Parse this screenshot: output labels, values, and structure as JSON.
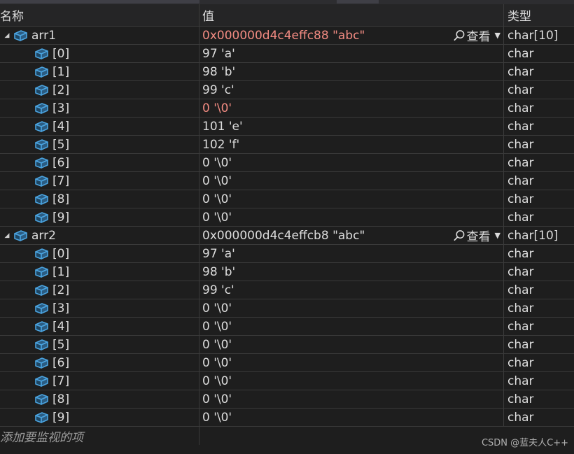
{
  "columns": {
    "name": "名称",
    "value": "值",
    "type": "类型"
  },
  "variables": [
    {
      "name": "arr1",
      "value": "0x000000d4c4effc88 \"abc\"",
      "value_changed": true,
      "type": "char[10]",
      "viewer_label": "查看",
      "children": [
        {
          "name": "[0]",
          "value": "97 'a'",
          "type": "char",
          "changed": false
        },
        {
          "name": "[1]",
          "value": "98 'b'",
          "type": "char",
          "changed": false
        },
        {
          "name": "[2]",
          "value": "99 'c'",
          "type": "char",
          "changed": false
        },
        {
          "name": "[3]",
          "value": "0 '\\0'",
          "type": "char",
          "changed": true
        },
        {
          "name": "[4]",
          "value": "101 'e'",
          "type": "char",
          "changed": false
        },
        {
          "name": "[5]",
          "value": "102 'f'",
          "type": "char",
          "changed": false
        },
        {
          "name": "[6]",
          "value": "0 '\\0'",
          "type": "char",
          "changed": false
        },
        {
          "name": "[7]",
          "value": "0 '\\0'",
          "type": "char",
          "changed": false
        },
        {
          "name": "[8]",
          "value": "0 '\\0'",
          "type": "char",
          "changed": false
        },
        {
          "name": "[9]",
          "value": "0 '\\0'",
          "type": "char",
          "changed": false
        }
      ]
    },
    {
      "name": "arr2",
      "value": "0x000000d4c4effcb8 \"abc\"",
      "value_changed": false,
      "type": "char[10]",
      "viewer_label": "查看",
      "children": [
        {
          "name": "[0]",
          "value": "97 'a'",
          "type": "char",
          "changed": false
        },
        {
          "name": "[1]",
          "value": "98 'b'",
          "type": "char",
          "changed": false
        },
        {
          "name": "[2]",
          "value": "99 'c'",
          "type": "char",
          "changed": false
        },
        {
          "name": "[3]",
          "value": "0 '\\0'",
          "type": "char",
          "changed": false
        },
        {
          "name": "[4]",
          "value": "0 '\\0'",
          "type": "char",
          "changed": false
        },
        {
          "name": "[5]",
          "value": "0 '\\0'",
          "type": "char",
          "changed": false
        },
        {
          "name": "[6]",
          "value": "0 '\\0'",
          "type": "char",
          "changed": false
        },
        {
          "name": "[7]",
          "value": "0 '\\0'",
          "type": "char",
          "changed": false
        },
        {
          "name": "[8]",
          "value": "0 '\\0'",
          "type": "char",
          "changed": false
        },
        {
          "name": "[9]",
          "value": "0 '\\0'",
          "type": "char",
          "changed": false
        }
      ]
    }
  ],
  "add_watch_placeholder": "添加要监视的项",
  "watermark": "CSDN @蓝夫人C++",
  "colors": {
    "changed_value": "#f28b82",
    "icon_blue": "#4aa3df",
    "background": "#1e1e1e"
  }
}
